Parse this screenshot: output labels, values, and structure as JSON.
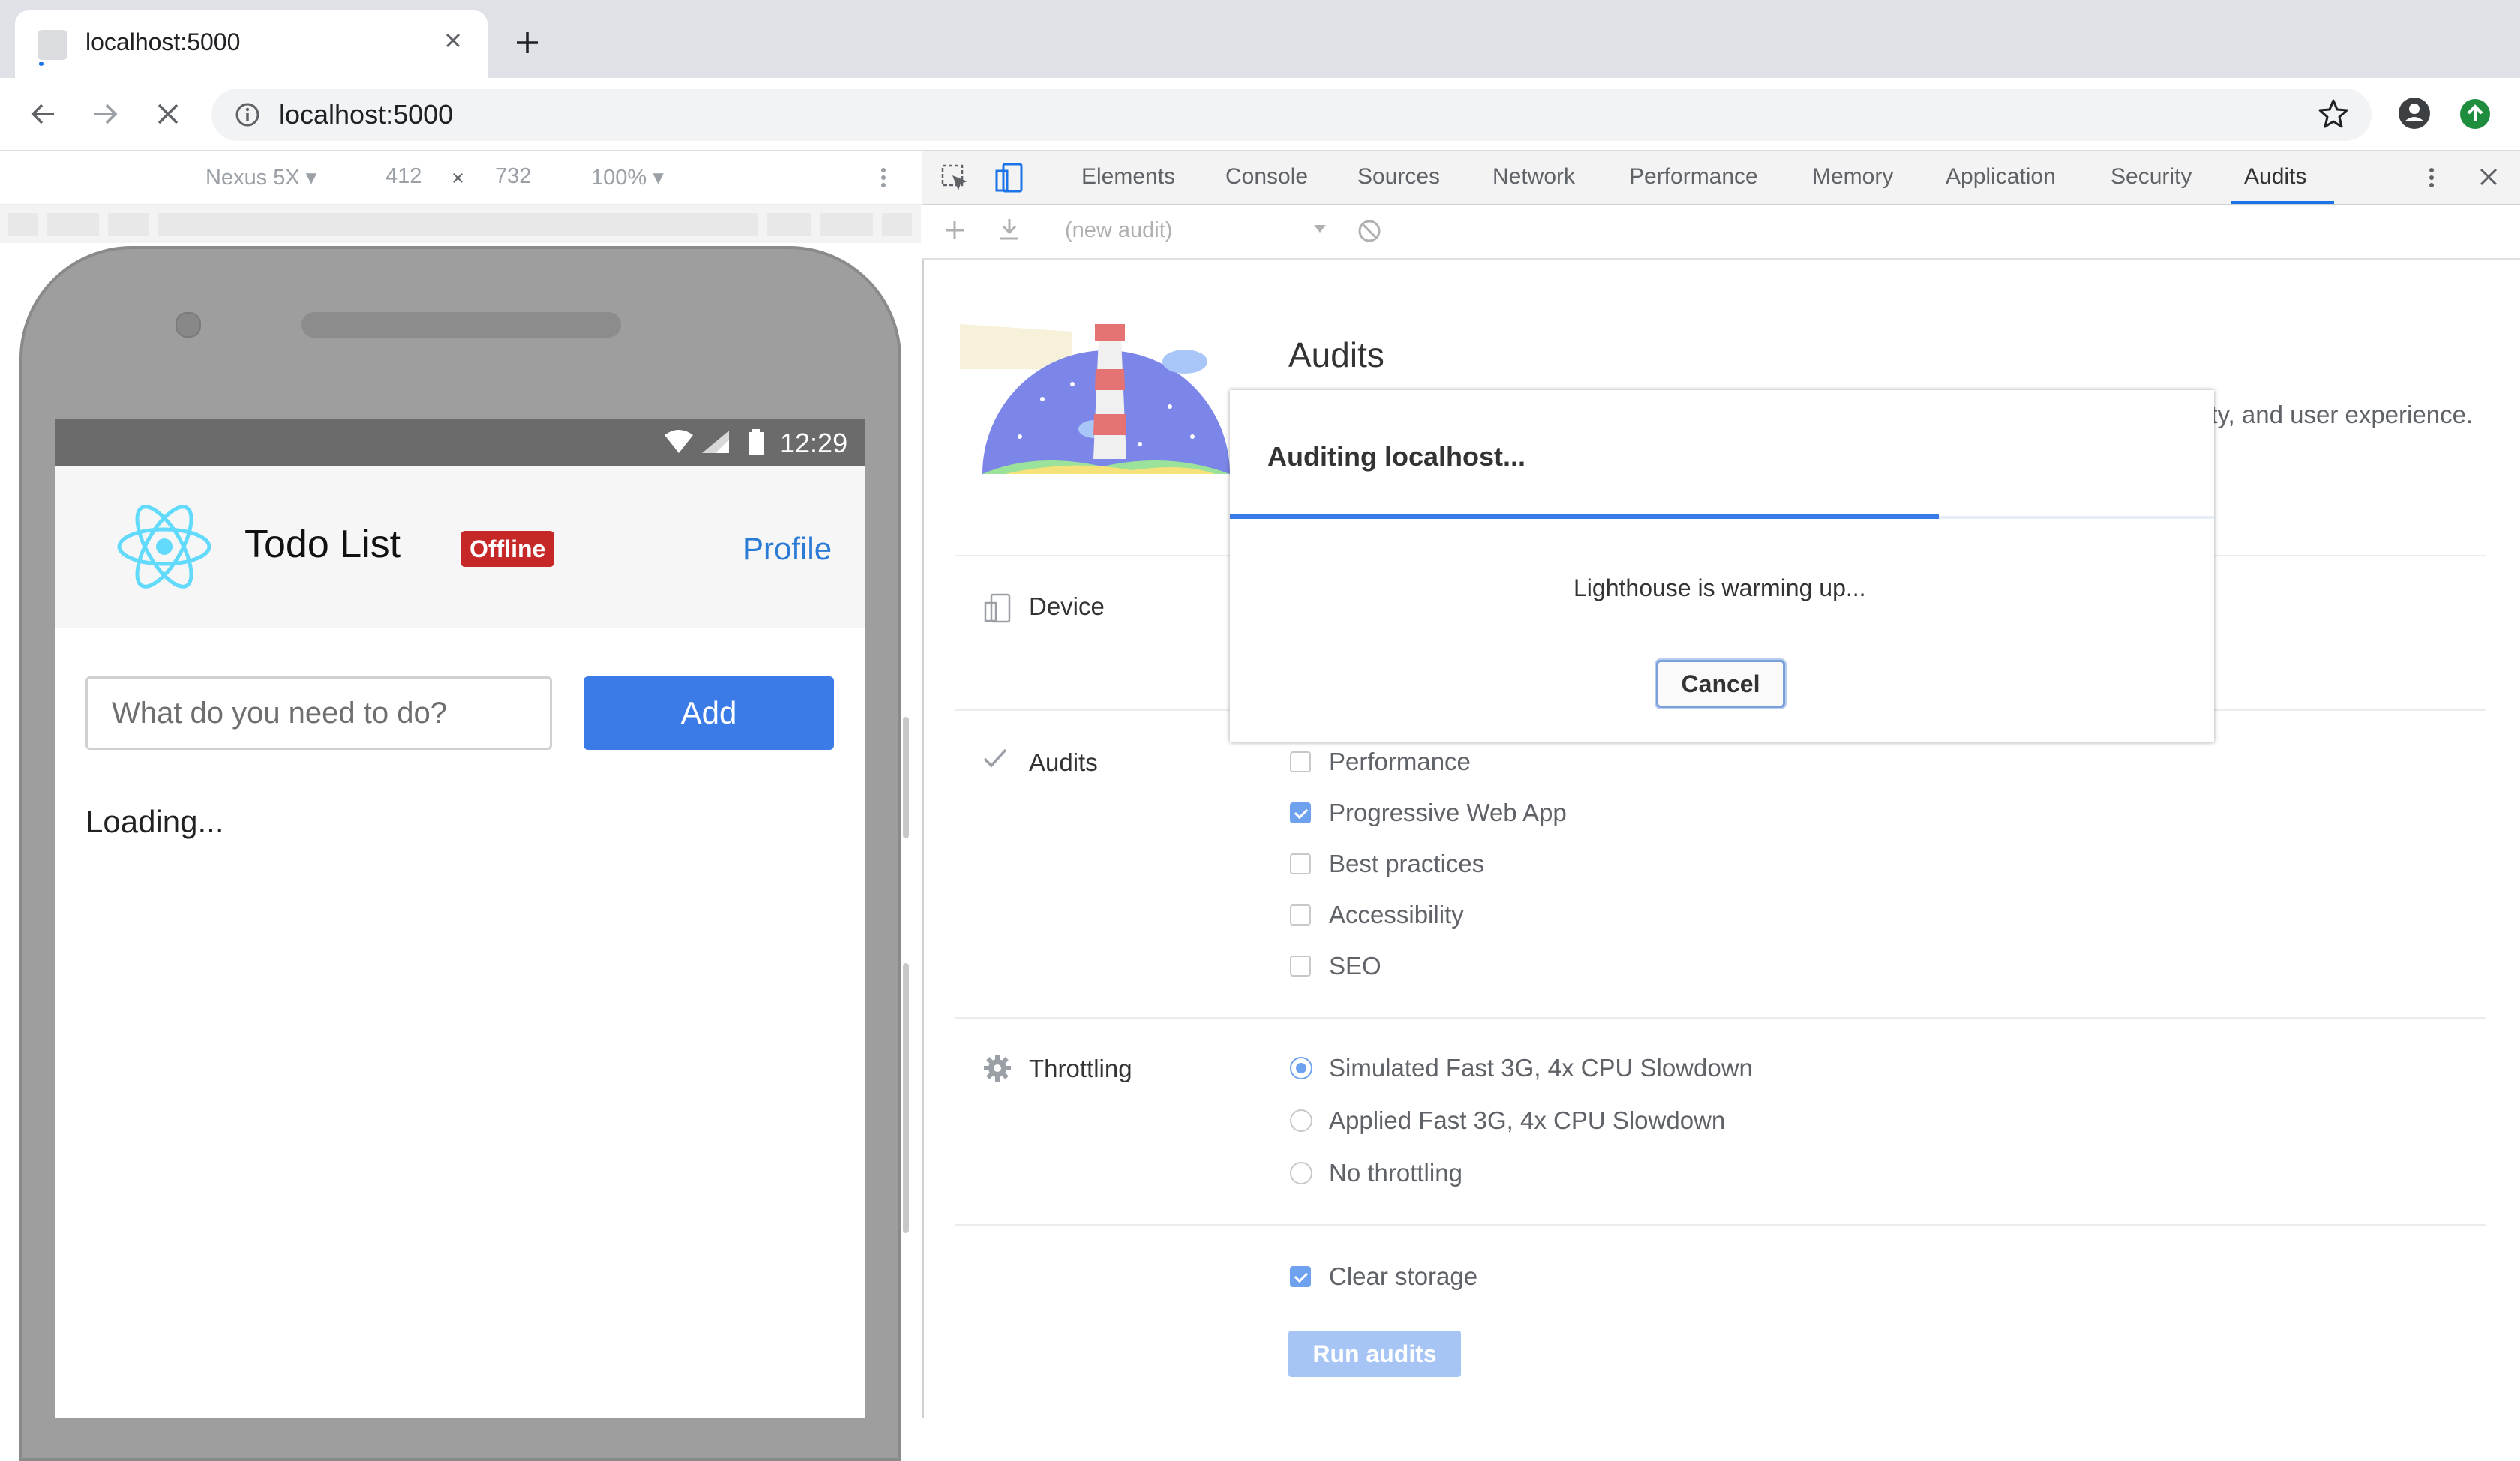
{
  "browser": {
    "tab_title": "localhost:5000",
    "url": "localhost:5000"
  },
  "device_toolbar": {
    "device": "Nexus 5X ▾",
    "width": "412",
    "times": "×",
    "height": "732",
    "zoom": "100% ▾"
  },
  "phone": {
    "time": "12:29"
  },
  "app": {
    "title": "Todo List",
    "badge": "Offline",
    "profile": "Profile",
    "input_placeholder": "What do you need to do?",
    "add_label": "Add",
    "loading": "Loading..."
  },
  "devtools": {
    "tabs": [
      "Elements",
      "Console",
      "Sources",
      "Network",
      "Performance",
      "Memory",
      "Application",
      "Security",
      "Audits"
    ],
    "active_tab": "Audits",
    "audit_select": "(new audit)",
    "audits_heading": "Audits",
    "intro_text_visible": "ity, and user experience.",
    "device_label": "Device",
    "audits_label": "Audits",
    "throttling_label": "Throttling",
    "categories": [
      {
        "label": "Performance",
        "checked": false
      },
      {
        "label": "Progressive Web App",
        "checked": true
      },
      {
        "label": "Best practices",
        "checked": false
      },
      {
        "label": "Accessibility",
        "checked": false
      },
      {
        "label": "SEO",
        "checked": false
      }
    ],
    "throttling": [
      {
        "label": "Simulated Fast 3G, 4x CPU Slowdown",
        "selected": true
      },
      {
        "label": "Applied Fast 3G, 4x CPU Slowdown",
        "selected": false
      },
      {
        "label": "No throttling",
        "selected": false
      }
    ],
    "clear_storage": {
      "label": "Clear storage",
      "checked": true
    },
    "run_audits": "Run audits"
  },
  "dialog": {
    "title": "Auditing localhost...",
    "status": "Lighthouse is warming up...",
    "cancel": "Cancel",
    "progress": 0.72
  },
  "colors": {
    "accent": "#1a73e8",
    "react": "#61dafb",
    "badge": "#c62828",
    "add_button": "#3b7be8"
  }
}
